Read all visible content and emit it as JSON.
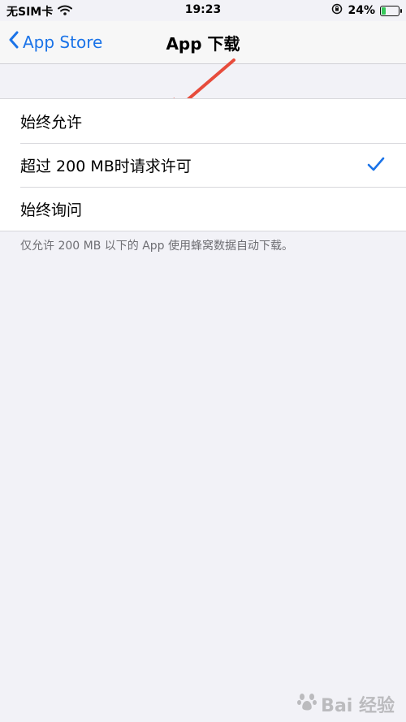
{
  "status": {
    "carrier": "无SIM卡",
    "time": "19:23",
    "battery": "24%",
    "battery_level": 0.24
  },
  "nav": {
    "back_label": "App Store",
    "title": "App 下载"
  },
  "options": [
    {
      "label": "始终允许",
      "selected": false
    },
    {
      "label": "超过 200 MB时请求许可",
      "selected": true
    },
    {
      "label": "始终询问",
      "selected": false
    }
  ],
  "footer_note": "仅允许 200 MB 以下的 App 使用蜂窝数据自动下载。",
  "watermark": {
    "text": "Bai 经验"
  },
  "colors": {
    "accent": "#1a73e8",
    "annotation_arrow": "#e74c3c",
    "battery": "#34c759"
  }
}
